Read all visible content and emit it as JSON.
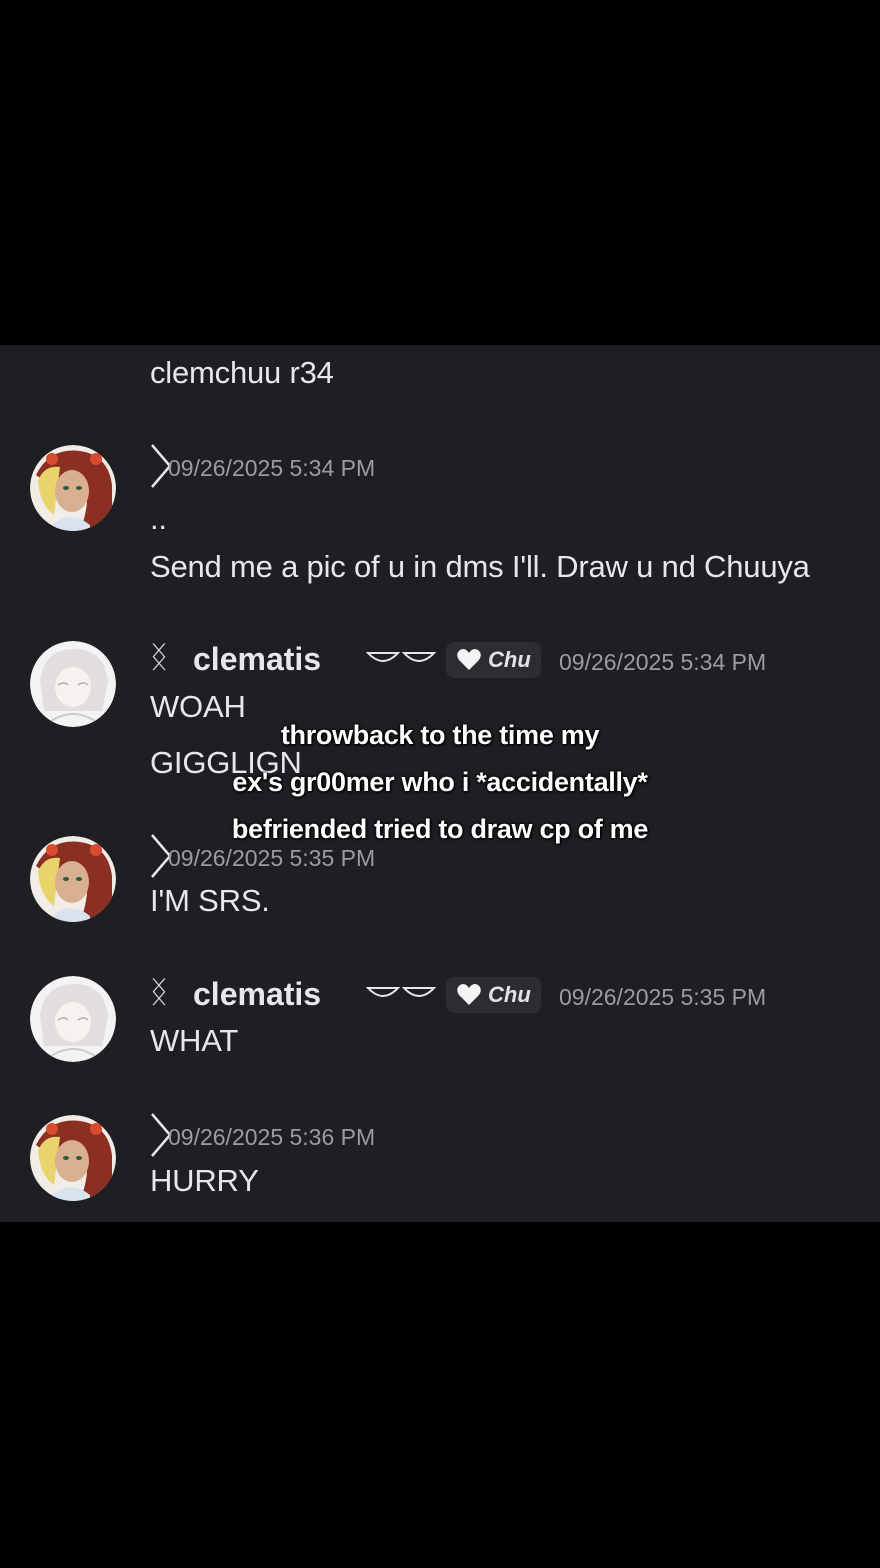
{
  "top_message": "clemchuu r34",
  "messages": [
    {
      "timestamp": "09/26/2025 5:34 PM",
      "lines": [
        "..",
        "Send me a pic of u in dms I'll. Draw u nd Chuuya"
      ]
    },
    {
      "author": "clematis",
      "tag": "Chu",
      "timestamp": "09/26/2025 5:34 PM",
      "lines": [
        "WOAH",
        "GIGGLIGN"
      ]
    },
    {
      "timestamp": "09/26/2025 5:35 PM",
      "lines": [
        "I'M SRS."
      ]
    },
    {
      "author": "clematis",
      "tag": "Chu",
      "timestamp": "09/26/2025 5:35 PM",
      "lines": [
        "WHAT"
      ]
    },
    {
      "timestamp": "09/26/2025 5:36 PM",
      "lines": [
        "HURRY"
      ]
    }
  ],
  "name_symbol": "ᛝ",
  "caption": [
    "throwback to the time my",
    "ex's gr00mer who i *accidentally*",
    "befriended tried to draw cp of me"
  ],
  "colors": {
    "chat_bg": "#1e1f22",
    "outer_bg": "#000000",
    "timestamp": "#9a9ca3",
    "text": "#e6e7ea"
  },
  "icons": [
    "reply-arrow-icon",
    "heart-icon",
    "closed-eyes-icon"
  ]
}
